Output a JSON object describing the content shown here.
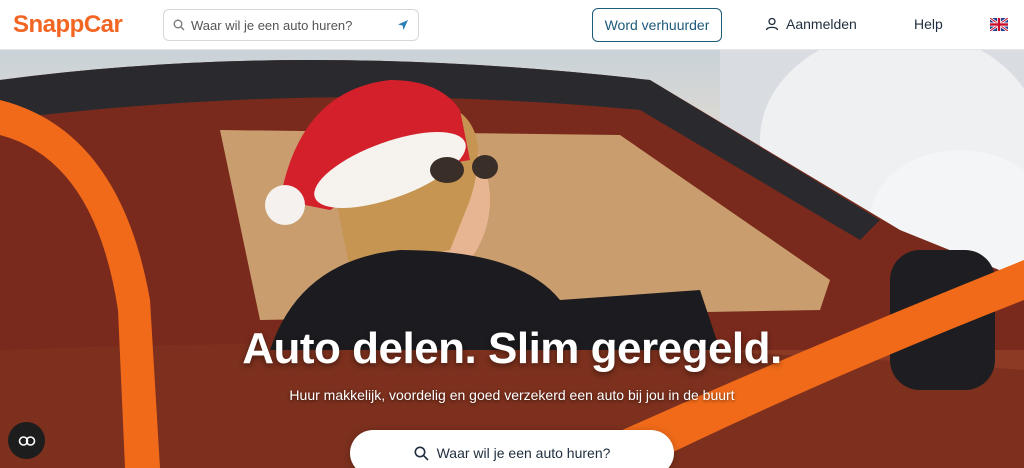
{
  "header": {
    "logo": "SnappCar",
    "search_placeholder": "Waar wil je een auto huren?",
    "become_owner_label": "Word verhuurder",
    "login_label": "Aanmelden",
    "help_label": "Help",
    "language_flag": "uk-flag-icon"
  },
  "hero": {
    "headline": "Auto delen. Slim geregeld.",
    "subline": "Huur makkelijk, voordelig en goed verzekerd een auto bij jou in de buurt",
    "search_label": "Waar wil je een auto huren?"
  },
  "colors": {
    "brand": "#f26522",
    "accent": "#1e5a7a"
  },
  "icons": [
    "search-icon",
    "location-arrow-icon",
    "user-icon",
    "uk-flag-icon",
    "accessibility-icon"
  ]
}
